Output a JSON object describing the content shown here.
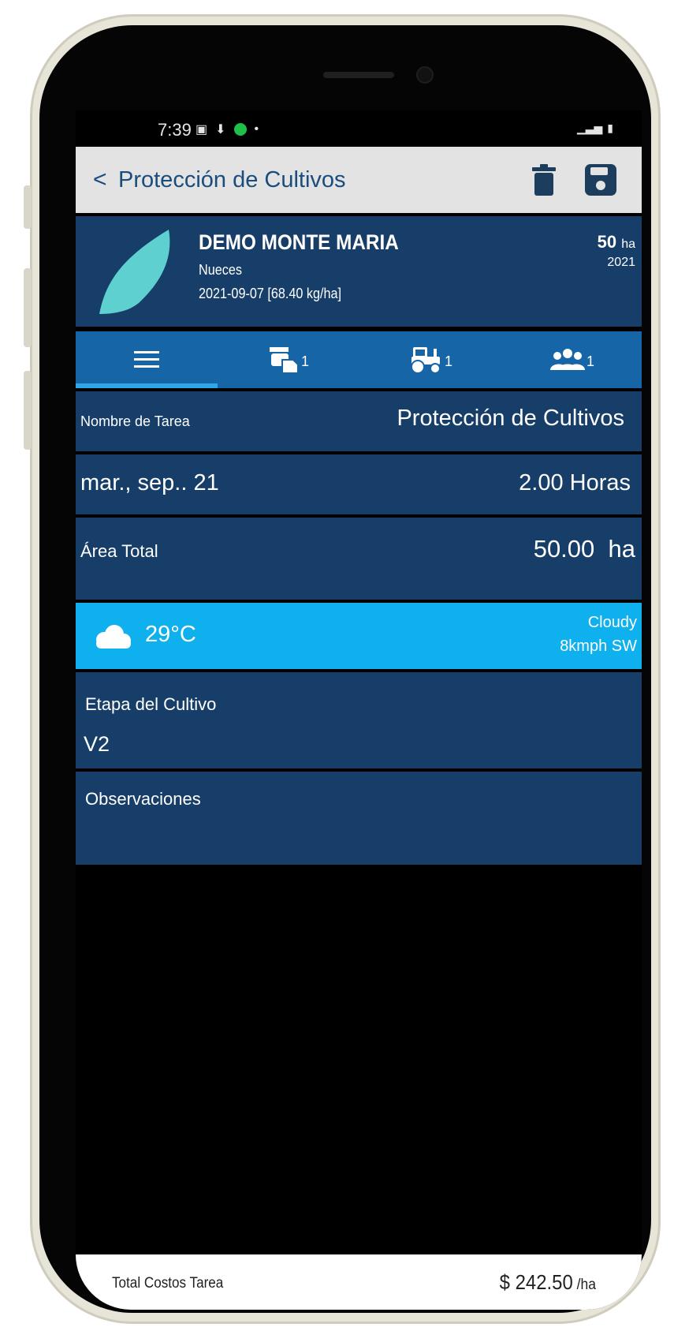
{
  "status_bar": {
    "time": "7:39"
  },
  "app_bar": {
    "back_label": "<",
    "title": "Protección de Cultivos",
    "delete_icon": "trash-icon",
    "save_icon": "save-icon"
  },
  "field": {
    "name": "DEMO MONTE MARIA",
    "crop": "Nueces",
    "sowing": "2021-09-07 [68.40 kg/ha]",
    "area_value": "50",
    "area_unit": "ha",
    "year": "2021"
  },
  "tabs": [
    {
      "icon": "menu-icon",
      "count": ""
    },
    {
      "icon": "sprayer-icon",
      "count": "1"
    },
    {
      "icon": "tractor-icon",
      "count": "1"
    },
    {
      "icon": "people-icon",
      "count": "1"
    }
  ],
  "task": {
    "name_label": "Nombre de Tarea",
    "name_value": "Protección de Cultivos",
    "date": "mar., sep.. 21",
    "hours": "2.00 Horas",
    "area_label": "Área Total",
    "area_value": "50.00  ha"
  },
  "weather": {
    "icon": "cloud-icon",
    "temperature": "29°C",
    "description": "Cloudy",
    "wind": "8kmph SW"
  },
  "crop_stage": {
    "label": "Etapa del Cultivo",
    "value": "V2"
  },
  "observations": {
    "label": "Observaciones",
    "value": ""
  },
  "footer": {
    "label": "Total Costos Tarea",
    "amount": "$ 242.50",
    "per": " /ha"
  },
  "colors": {
    "primary_dark": "#163e68",
    "tab_bar": "#1665a6",
    "weather_bg": "#0fb0ee",
    "accent_text": "#1a4d7e"
  }
}
